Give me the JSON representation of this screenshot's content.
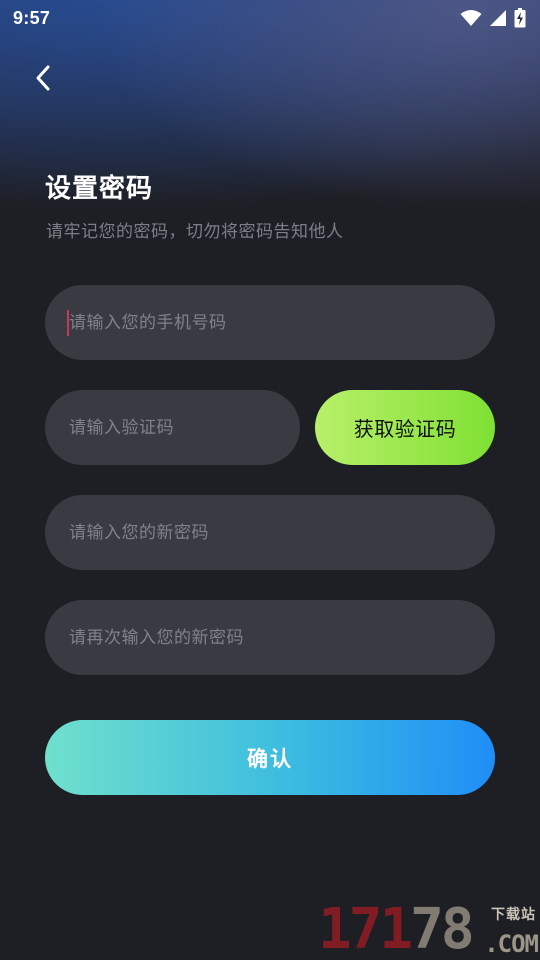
{
  "status_bar": {
    "time": "9:57",
    "icons": [
      "wifi-icon",
      "cell-signal-icon",
      "battery-charging-icon"
    ]
  },
  "header": {
    "back_icon": "chevron-left-icon"
  },
  "page": {
    "title": "设置密码",
    "subtitle": "请牢记您的密码，切勿将密码告知他人"
  },
  "form": {
    "phone_placeholder": "请输入您的手机号码",
    "phone_value": "",
    "code_placeholder": "请输入验证码",
    "code_value": "",
    "get_code_label": "获取验证码",
    "new_password_placeholder": "请输入您的新密码",
    "new_password_value": "",
    "repeat_password_placeholder": "请再次输入您的新密码",
    "repeat_password_value": "",
    "confirm_label": "确认"
  },
  "watermark": {
    "number_main": "171",
    "number_tail": "78",
    "top_text": "下载站",
    "domain": ".COM"
  },
  "colors": {
    "background": "#1e1f25",
    "field_background": "#3a3b42",
    "get_code_gradient": [
      "#b8f06a",
      "#7fe033"
    ],
    "confirm_gradient": [
      "#6fe0cc",
      "#1f8ef7"
    ],
    "caret": "#c4395a"
  }
}
